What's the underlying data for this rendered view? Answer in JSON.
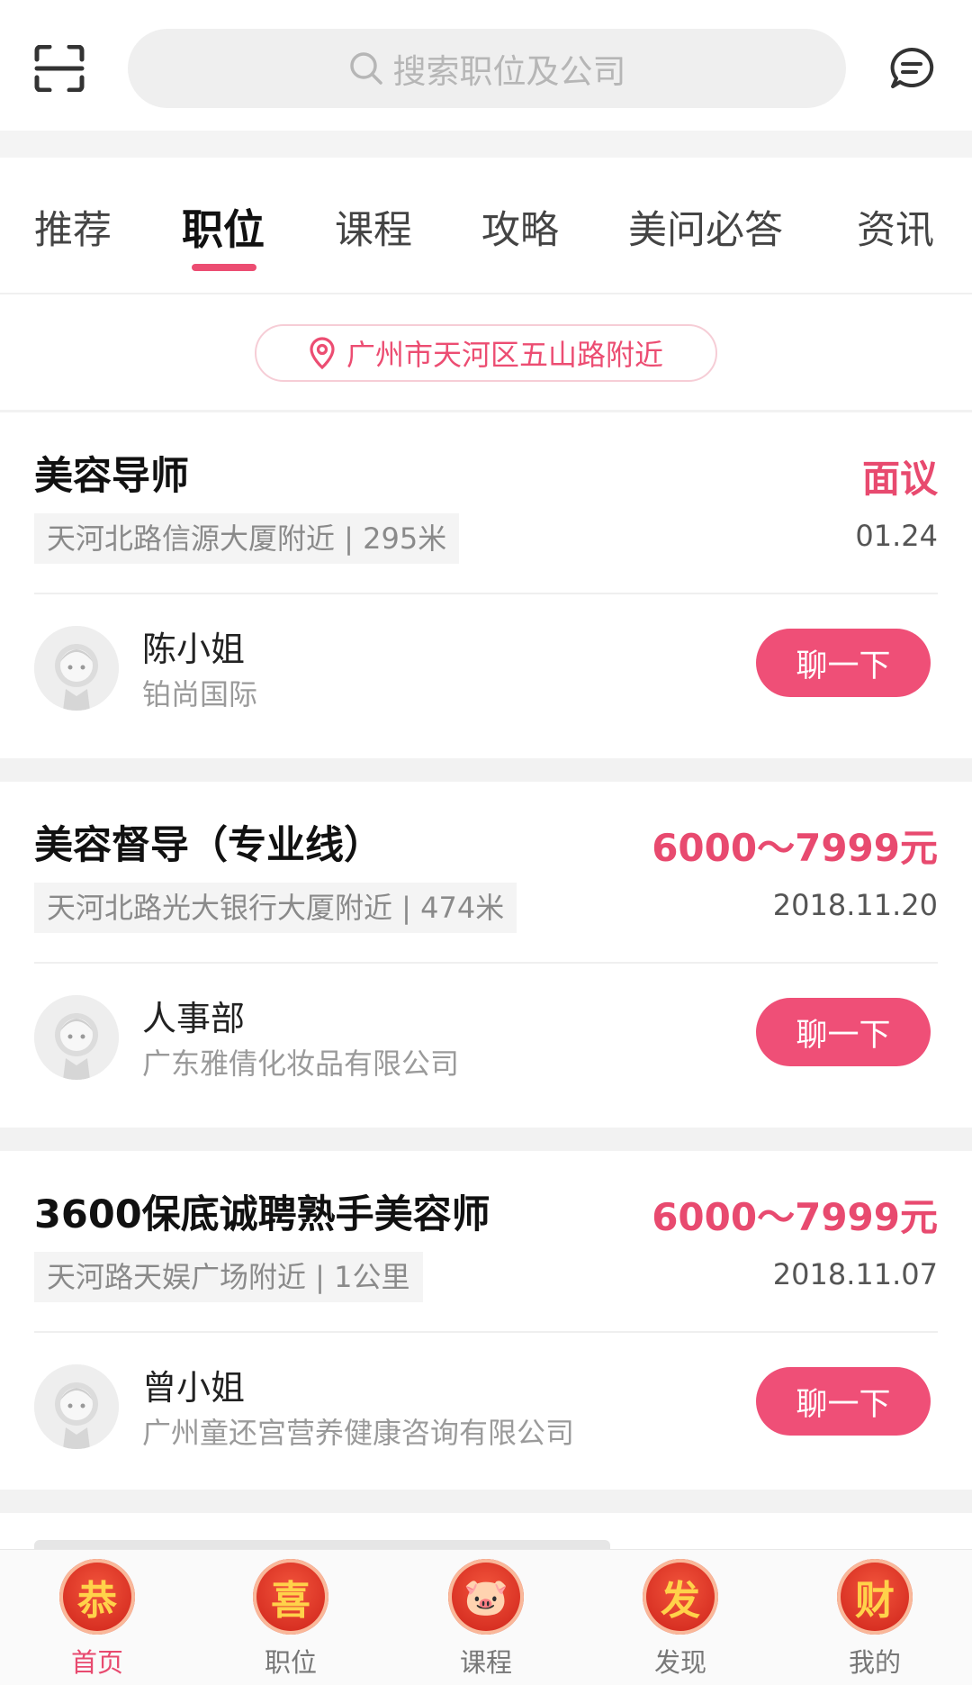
{
  "search": {
    "placeholder": "搜索职位及公司"
  },
  "tabs": [
    {
      "label": "推荐",
      "active": false
    },
    {
      "label": "职位",
      "active": true
    },
    {
      "label": "课程",
      "active": false
    },
    {
      "label": "攻略",
      "active": false
    },
    {
      "label": "美问必答",
      "active": false
    },
    {
      "label": "资讯",
      "active": false
    }
  ],
  "location": {
    "text": "广州市天河区五山路附近"
  },
  "jobs": [
    {
      "title": "美容导师",
      "salary": "面议",
      "location": "天河北路信源大厦附近 | 295米",
      "date": "01.24",
      "contact": "陈小姐",
      "company": "铂尚国际",
      "chat_label": "聊一下"
    },
    {
      "title": "美容督导（专业线）",
      "salary": "6000～7999元",
      "location": "天河北路光大银行大厦附近 | 474米",
      "date": "2018.11.20",
      "contact": "人事部",
      "company": "广东雅倩化妆品有限公司",
      "chat_label": "聊一下"
    },
    {
      "title": "3600保底诚聘熟手美容师",
      "salary": "6000～7999元",
      "location": "天河路天娱广场附近 | 1公里",
      "date": "2018.11.07",
      "contact": "曾小姐",
      "company": "广州童还宫营养健康咨询有限公司",
      "chat_label": "聊一下"
    }
  ],
  "bottom_nav": [
    {
      "badge": "恭",
      "label": "首页"
    },
    {
      "badge": "喜",
      "label": "职位"
    },
    {
      "badge": "🐷",
      "label": "课程"
    },
    {
      "badge": "发",
      "label": "发现"
    },
    {
      "badge": "财",
      "label": "我的"
    }
  ],
  "colors": {
    "accent": "#ec4d72",
    "chat_button": "#ef4f77",
    "salary": "#e84a6f"
  },
  "icons": {
    "scan": "scan-icon",
    "search": "search-icon",
    "message": "message-icon",
    "location": "location-pin-icon"
  }
}
